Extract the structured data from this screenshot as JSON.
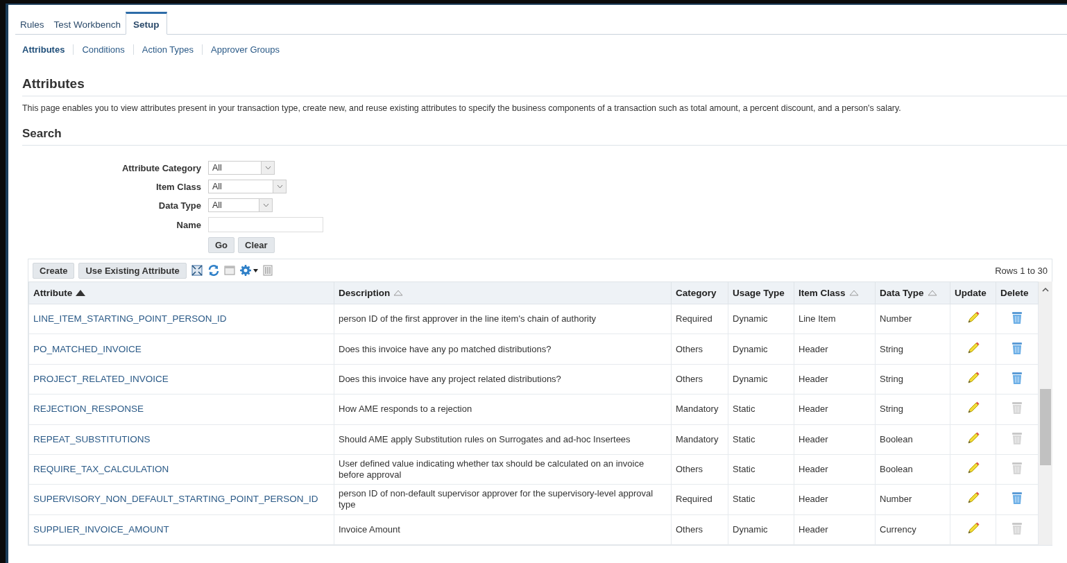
{
  "tabs": [
    {
      "label": "Rules",
      "selected": false
    },
    {
      "label": "Test Workbench",
      "selected": false
    },
    {
      "label": "Setup",
      "selected": true
    }
  ],
  "subtabs": [
    {
      "label": "Attributes",
      "selected": true
    },
    {
      "label": "Conditions",
      "selected": false
    },
    {
      "label": "Action Types",
      "selected": false
    },
    {
      "label": "Approver Groups",
      "selected": false
    }
  ],
  "page_title": "Attributes",
  "intro": "This page enables you to view attributes present in your transaction type, create new, and reuse existing attributes to specify the business components of a transaction such as total amount, a percent discount, and a person's salary.",
  "search": {
    "title": "Search",
    "fields": [
      {
        "kind": "select",
        "label": "Attribute Category",
        "value": "All"
      },
      {
        "kind": "select",
        "label": "Item Class",
        "value": "All"
      },
      {
        "kind": "select",
        "label": "Data Type",
        "value": "All"
      },
      {
        "kind": "text",
        "label": "Name"
      }
    ],
    "buttons": [
      "Go",
      "Clear"
    ]
  },
  "toolbar": {
    "buttons": [
      "Create",
      "Use Existing Attribute"
    ],
    "rows_info": "Rows 1 to 30"
  },
  "table": {
    "columns": [
      {
        "label": "Attribute",
        "sortable": true,
        "sorted": true
      },
      {
        "label": "Description",
        "sortable": true,
        "sorted": false
      },
      {
        "label": "Category",
        "sortable": false,
        "sorted": false
      },
      {
        "label": "Usage Type",
        "sortable": false,
        "sorted": false
      },
      {
        "label": "Item Class",
        "sortable": true,
        "sorted": false
      },
      {
        "label": "Data Type",
        "sortable": true,
        "sorted": false
      },
      {
        "label": "Update",
        "sortable": false,
        "sorted": false
      },
      {
        "label": "Delete",
        "sortable": false,
        "sorted": false
      }
    ],
    "rows": [
      {
        "attribute": "LINE_ITEM_STARTING_POINT_PERSON_ID",
        "description": "person ID of the first approver in the line item's chain of authority",
        "category": "Required",
        "usage_type": "Dynamic",
        "item_class": "Line Item",
        "data_type": "Number",
        "delete_disabled": false
      },
      {
        "attribute": "PO_MATCHED_INVOICE",
        "description": "Does this invoice have any po matched distributions?",
        "category": "Others",
        "usage_type": "Dynamic",
        "item_class": "Header",
        "data_type": "String",
        "delete_disabled": false
      },
      {
        "attribute": "PROJECT_RELATED_INVOICE",
        "description": "Does this invoice have any project related distributions?",
        "category": "Others",
        "usage_type": "Dynamic",
        "item_class": "Header",
        "data_type": "String",
        "delete_disabled": false
      },
      {
        "attribute": "REJECTION_RESPONSE",
        "description": "How AME responds to a rejection",
        "category": "Mandatory",
        "usage_type": "Static",
        "item_class": "Header",
        "data_type": "String",
        "delete_disabled": true
      },
      {
        "attribute": "REPEAT_SUBSTITUTIONS",
        "description": "Should AME apply Substitution rules on Surrogates and ad-hoc Insertees",
        "category": "Mandatory",
        "usage_type": "Static",
        "item_class": "Header",
        "data_type": "Boolean",
        "delete_disabled": true
      },
      {
        "attribute": "REQUIRE_TAX_CALCULATION",
        "description": "User defined value indicating whether tax should be calculated on an invoice before approval",
        "category": "Others",
        "usage_type": "Static",
        "item_class": "Header",
        "data_type": "Boolean",
        "delete_disabled": true
      },
      {
        "attribute": "SUPERVISORY_NON_DEFAULT_STARTING_POINT_PERSON_ID",
        "description": "person ID of non-default supervisor approver for the supervisory-level approval type",
        "category": "Required",
        "usage_type": "Static",
        "item_class": "Header",
        "data_type": "Number",
        "delete_disabled": false
      },
      {
        "attribute": "SUPPLIER_INVOICE_AMOUNT",
        "description": "Invoice Amount",
        "category": "Others",
        "usage_type": "Dynamic",
        "item_class": "Header",
        "data_type": "Currency",
        "delete_disabled": true
      }
    ]
  }
}
